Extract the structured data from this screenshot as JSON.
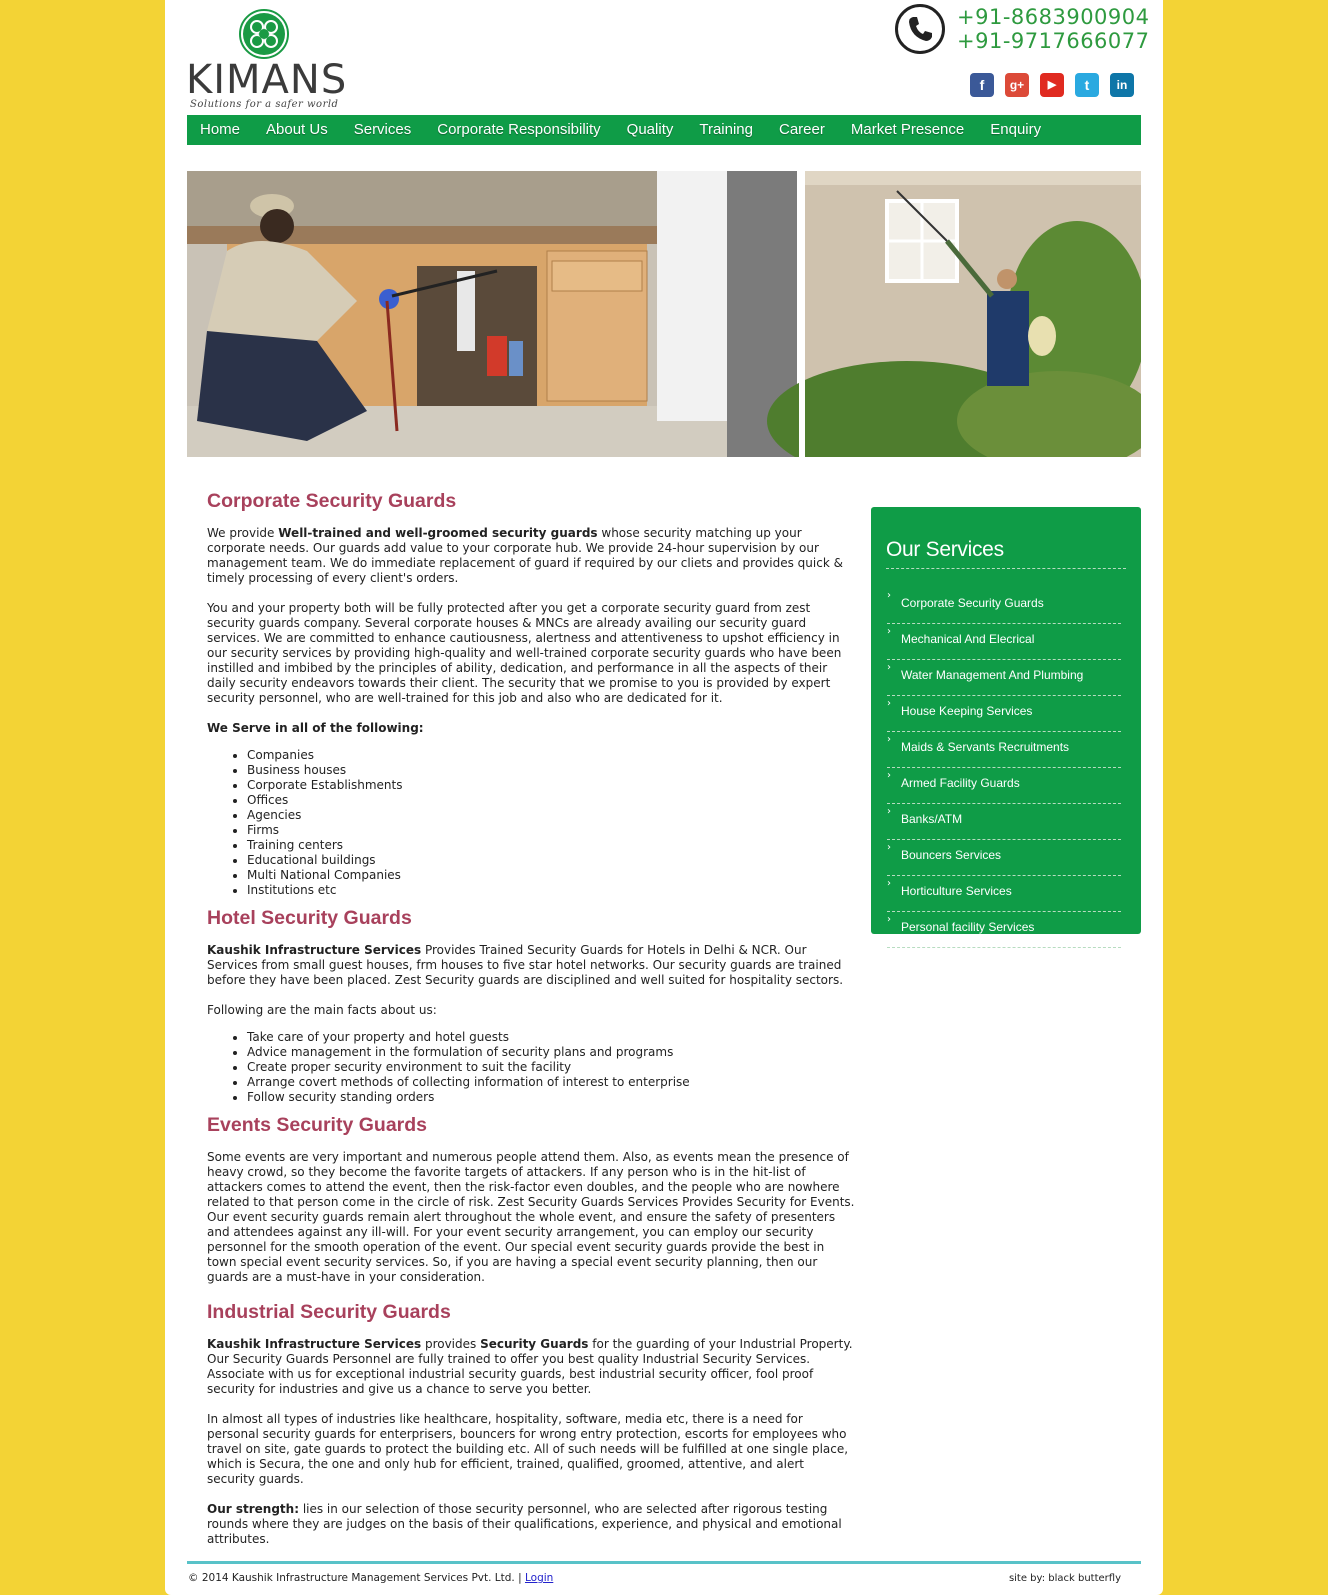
{
  "brand": {
    "name": "KIMANS",
    "tagline": "Solutions for a safer world"
  },
  "contact": {
    "phone1": "+91-8683900904",
    "phone2": "+91-9717666077"
  },
  "social": [
    {
      "icon": "facebook-icon",
      "glyph": "f",
      "color": "#3b5998"
    },
    {
      "icon": "google-plus-icon",
      "glyph": "g+",
      "color": "#dc4a38"
    },
    {
      "icon": "youtube-icon",
      "glyph": "▶",
      "color": "#e02a20"
    },
    {
      "icon": "twitter-icon",
      "glyph": "t",
      "color": "#2aa9e0"
    },
    {
      "icon": "linkedin-icon",
      "glyph": "in",
      "color": "#0e76a8"
    }
  ],
  "nav": {
    "home": "Home",
    "about": "About Us",
    "services": "Services",
    "csr": "Corporate Responsibility",
    "quality": "Quality",
    "training": "Training",
    "career": "Career",
    "market": "Market Presence",
    "enquiry": "Enquiry"
  },
  "sections": {
    "corporate": {
      "title": "Corporate Security Guards",
      "p1_pre": "We provide ",
      "p1_bold": "Well-trained and well-groomed security guards",
      "p1_post": " whose security matching up your corporate needs. Our guards add value to your corporate hub. We provide 24-hour supervision by our management team. We do immediate replacement of guard if required by our cliets and provides quick & timely processing of every client's orders.",
      "p2": "You and your property both will be fully protected after you get a corporate security guard from zest security guards company. Several corporate houses & MNCs are already availing our security guard services. We are committed to enhance cautiousness, alertness and attentiveness to upshot efficiency in our security services by providing high-quality and well-trained corporate security guards who have been instilled and imbibed by the principles of ability, dedication, and performance in all the aspects of their daily security endeavors towards their client. The security that we promise to you is provided by expert security personnel, who are well-trained for this job and also who are dedicated for it.",
      "serve_heading": "We Serve in all of the following:",
      "serve_list": [
        "Companies",
        "Business houses",
        "Corporate Establishments",
        "Offices",
        "Agencies",
        "Firms",
        "Training centers",
        "Educational buildings",
        "Multi National Companies",
        "Institutions etc"
      ]
    },
    "hotel": {
      "title": "Hotel Security Guards",
      "p1_bold": "Kaushik Infrastructure Services",
      "p1_post": " Provides Trained Security Guards for Hotels in Delhi & NCR. Our Services from small guest houses, frm houses to five star hotel networks. Our security guards are trained before they have been placed. Zest Security guards are disciplined and well suited for hospitality sectors.",
      "facts_heading": "Following are the main facts about us:",
      "facts": [
        "Take care of your property and hotel guests",
        "Advice management in the formulation of security plans and programs",
        "Create proper security environment to suit the facility",
        "Arrange covert methods of collecting information of interest to enterprise",
        "Follow security standing orders"
      ]
    },
    "events": {
      "title": "Events Security Guards",
      "p1": "Some events are very important and numerous people attend them. Also, as events mean the presence of heavy crowd, so they become the favorite targets of attackers. If any person who is in the hit-list of attackers comes to attend the event, then the risk-factor even doubles, and the people who are nowhere related to that person come in the circle of risk. Zest Security Guards Services Provides Security for Events. Our event security guards remain alert throughout the whole event, and ensure the safety of presenters and attendees against any ill-will. For your event security arrangement, you can employ our security personnel for the smooth operation of the event. Our special event security guards provide the best in town special event security services. So, if you are having a special event security planning, then our guards are a must-have in your consideration."
    },
    "industrial": {
      "title": "Industrial Security Guards",
      "p1_bold1": "Kaushik Infrastructure Services",
      "p1_mid": " provides ",
      "p1_bold2": "Security Guards",
      "p1_post": " for the guarding of your Industrial Property. Our Security Guards Personnel are fully trained to offer you best quality Industrial Security Services. Associate with us for exceptional industrial security guards, best industrial security officer, fool proof security for industries and give us a chance to serve you better.",
      "p2": "In almost all types of industries like healthcare, hospitality, software, media etc, there is a need for personal security guards for enterprisers, bouncers for wrong entry protection, escorts for employees who travel on site, gate guards to protect the building etc. All of such needs will be fulfilled at one single place, which is Secura, the one and only hub for efficient, trained, qualified, groomed, attentive, and alert security guards.",
      "p3_bold": "Our strength:",
      "p3_post": " lies in our selection of those security personnel, who are selected after rigorous testing rounds where they are judges on the basis of their qualifications, experience, and physical and emotional attributes."
    }
  },
  "sidebar": {
    "title": "Our Services",
    "items": [
      "Corporate Security Guards",
      "Mechanical And Elecrical",
      "Water Management And Plumbing",
      "House Keeping Services",
      "Maids & Servants Recruitments",
      "Armed Facility Guards",
      "Banks/ATM",
      "Bouncers Services",
      "Horticulture Services",
      "Personal facility Services"
    ]
  },
  "footer": {
    "copyright": "© 2014 Kaushik Infrastructure Management Services Pvt. Ltd. | ",
    "login": "Login",
    "credit": "site by: black butterfly"
  },
  "colors": {
    "background": "#f3d335",
    "nav_green": "#0f9c47",
    "heading": "#a8415c",
    "phone": "#2e9a3f",
    "footer_rule": "#58c2c8"
  }
}
